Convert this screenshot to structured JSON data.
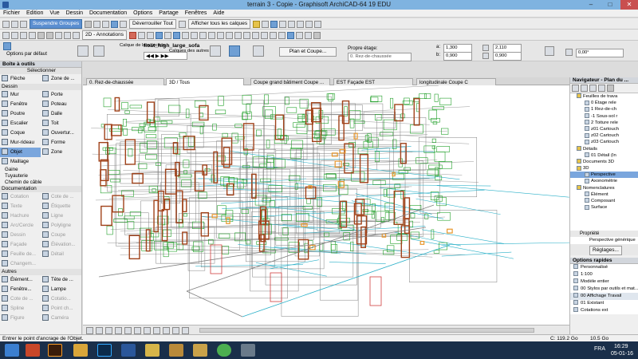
{
  "window": {
    "title": "terrain 3 - Copie - Graphisoft ArchiCAD-64 19 EDU",
    "controls": [
      "–",
      "□",
      "✕"
    ]
  },
  "menu": [
    "Fichier",
    "Edition",
    "Vue",
    "Dessin",
    "Documentation",
    "Options",
    "Partage",
    "Fenêtres",
    "Aide"
  ],
  "toolbar1": {
    "suspend_groups": "Suspendre Groupes",
    "unlock_all": "Déverrouiller Tout",
    "show_all_layers": "Afficher tous les calques"
  },
  "toolbar2": {
    "annotations": "2D - Annotations"
  },
  "infobox": {
    "default_options": "Options par défaut",
    "object_name": "float_high_large_sofa",
    "selection_layer": "Calque de la sélection",
    "other_layers": "Calques des autres",
    "plan_section": "Plan et Coupe...",
    "own_floor": "Propre étage:",
    "floor_value": "0. Rez-de-chaussée",
    "a_value": "1,300",
    "b_value": "0,900",
    "h_value": "2,110",
    "h2_value": "0,900",
    "angle_value": "0,00°",
    "a_label": "a:",
    "b_label": "b:"
  },
  "toolbox": {
    "title": "Boîte à outils",
    "select_label": "Sélectionner",
    "pointer": "Flèche",
    "zone_label": "Zone de ...",
    "design_section": "Dessin",
    "tools": [
      "Mur",
      "Porte",
      "Fenêtre",
      "Poteau",
      "Poutre",
      "Dalle",
      "Escalier",
      "Toit",
      "Coque",
      "Ouvertur...",
      "Mur-rideau",
      "Forme",
      "Objet",
      "Zone",
      "Maillage"
    ],
    "more_items": [
      "Gaine",
      "Tuyauterie",
      "Chemin de câble"
    ],
    "doc_section": "Documentation",
    "doc_tools": [
      "Cotation",
      "Cote de ...",
      "Texte",
      "Étiquette",
      "Hachure",
      "Ligne",
      "Arc/Cercle",
      "Polyligne",
      "Dessin",
      "Coupe",
      "Façade",
      "Élévation...",
      "Feuille de...",
      "Détail",
      "Changem..."
    ],
    "other_section": "Autres",
    "other_tools": [
      "Élément...",
      "Tête de ...",
      "Fenêtre...",
      "Lampe",
      "Cote de ...",
      "Cotatio...",
      "Spline",
      "Point ch...",
      "Figure",
      "Caméra"
    ]
  },
  "tabs": [
    "0. Rez-de-chaussée",
    "3D / Tous",
    "Coupe grand bâtiment  Coupe ...",
    "EST Façade EST",
    "longitudinale Coupe C"
  ],
  "navigator": {
    "title": "Navigateur - Plan du ...",
    "tree": [
      {
        "label": "Feuilles de trava",
        "level": 1
      },
      {
        "label": "0 Étage rele",
        "level": 2
      },
      {
        "label": "1 Rez-de-ch",
        "level": 2
      },
      {
        "label": "-1 Sous-sol r",
        "level": 2
      },
      {
        "label": "2 Toiture rele",
        "level": 2
      },
      {
        "label": "z01 Cartouch",
        "level": 2
      },
      {
        "label": "z02 Cartouch",
        "level": 2
      },
      {
        "label": "z03 Cartouch",
        "level": 2
      },
      {
        "label": "Détails",
        "level": 1
      },
      {
        "label": "01 Détail (In",
        "level": 2
      },
      {
        "label": "Documents 3D",
        "level": 1
      },
      {
        "label": "3D",
        "level": 1
      },
      {
        "label": "Perspective",
        "level": 2,
        "selected": true
      },
      {
        "label": "Axonométrie",
        "level": 2
      },
      {
        "label": "Nomenclatures",
        "level": 1
      },
      {
        "label": "Élément",
        "level": 2
      },
      {
        "label": "Composant",
        "level": 2
      },
      {
        "label": "Surface",
        "level": 2
      }
    ],
    "properties_label": "Propriété",
    "properties_value": "Perspective générique",
    "settings_button": "Réglages..."
  },
  "quick_options": {
    "title": "Options rapides",
    "items": [
      "Personnalisé",
      "1:100",
      "Modèle entier",
      "00 Stylos par outils et mat...",
      "00 Affichage Travail",
      "01 Existant",
      "Cotations ext"
    ]
  },
  "viewport_bar": {
    "zoom": "C: 119.2 Go",
    "disk": "10.5 Go"
  },
  "status": {
    "hint": "Entrer le point d'ancrage de l'Objet."
  },
  "taskbar": {
    "lang": "FRA",
    "time": "16:29",
    "date": "05-01-16",
    "apps": [
      "windows",
      "powerpoint",
      "illustrator",
      "explorer",
      "photoshop",
      "word",
      "files",
      "explorer2",
      "chrome",
      "archicad"
    ]
  },
  "colors": {
    "wire_gray": "#808080",
    "wire_green": "#22a02a",
    "wire_brown": "#a0421a",
    "wire_cyan": "#2ab0c8",
    "wire_orange": "#e8962a",
    "wire_red": "#d04040"
  }
}
